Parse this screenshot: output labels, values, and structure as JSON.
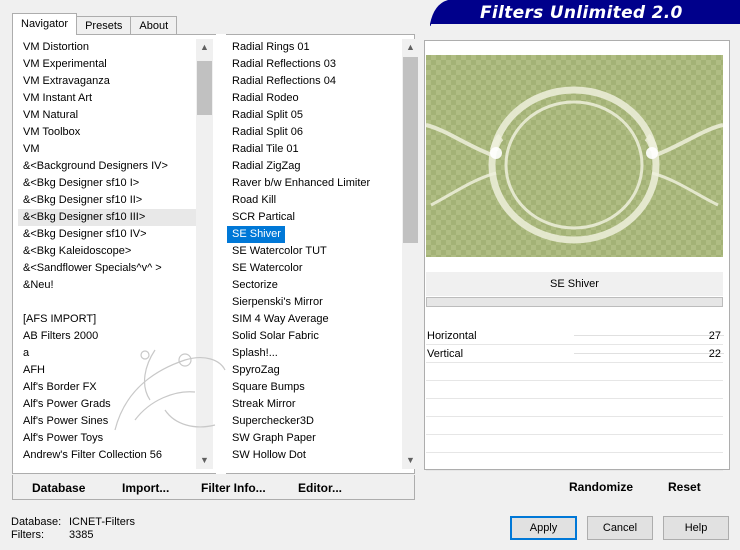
{
  "header": {
    "title": "Filters Unlimited 2.0"
  },
  "tabs": [
    {
      "label": "Navigator",
      "active": true
    },
    {
      "label": "Presets",
      "active": false
    },
    {
      "label": "About",
      "active": false
    }
  ],
  "categories": [
    "VM Distortion",
    "VM Experimental",
    "VM Extravaganza",
    "VM Instant Art",
    "VM Natural",
    "VM Toolbox",
    "VM",
    "&<Background Designers IV>",
    "&<Bkg Designer sf10 I>",
    "&<Bkg Designer sf10 II>",
    "&<Bkg Designer sf10 III>",
    "&<Bkg Designer sf10 IV>",
    "&<Bkg Kaleidoscope>",
    "&<Sandflower Specials^v^ >",
    "&Neu!",
    "",
    "[AFS IMPORT]",
    "AB Filters 2000",
    "a",
    "AFH",
    "Alf's Border FX",
    "Alf's Power Grads",
    "Alf's Power Sines",
    "Alf's Power Toys",
    "Andrew's Filter Collection 56"
  ],
  "filters": [
    "Radial  Rings 01",
    "Radial Reflections 03",
    "Radial Reflections 04",
    "Radial Rodeo",
    "Radial Split 05",
    "Radial Split 06",
    "Radial Tile 01",
    "Radial ZigZag",
    "Raver b/w Enhanced Limiter",
    "Road Kill",
    "SCR  Partical",
    "SE Shiver",
    "SE Watercolor TUT",
    "SE Watercolor",
    "Sectorize",
    "Sierpenski's Mirror",
    "SIM 4 Way Average",
    "Solid Solar Fabric",
    "Splash!...",
    "SpyroZag",
    "Square Bumps",
    "Streak Mirror",
    "Superchecker3D",
    "SW Graph Paper",
    "SW Hollow Dot"
  ],
  "toolbar": {
    "database": "Database",
    "import": "Import...",
    "filter_info": "Filter Info...",
    "editor": "Editor..."
  },
  "selected_filter": "SE Shiver",
  "params": [
    {
      "name": "Horizontal",
      "value": "27"
    },
    {
      "name": "Vertical",
      "value": "22"
    }
  ],
  "actions": {
    "randomize": "Randomize",
    "reset": "Reset"
  },
  "status": {
    "database_label": "Database:",
    "database_value": "ICNET-Filters",
    "filters_label": "Filters:",
    "filters_value": "3385"
  },
  "buttons": {
    "apply": "Apply",
    "cancel": "Cancel",
    "help": "Help"
  },
  "colors": {
    "accent": "#0078d7",
    "banner": "#00008b",
    "preview_bg": "#b3c088"
  }
}
